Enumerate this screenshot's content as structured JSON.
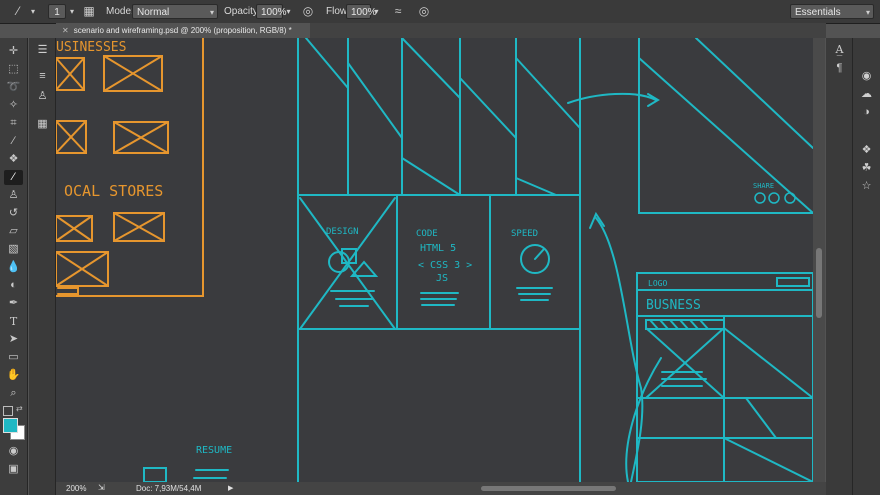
{
  "options_bar": {
    "brush_size": "1",
    "mode_label": "Mode:",
    "mode_value": "Normal",
    "opacity_label": "Opacity:",
    "opacity_value": "100%",
    "flow_label": "Flow:",
    "flow_value": "100%",
    "workspace": "Essentials"
  },
  "document_tab": {
    "title": "scenario and wireframing.psd @ 200% (proposition, RGB/8) *"
  },
  "status_bar": {
    "zoom": "200%",
    "doc_size": "Doc: 7,93M/54,4M"
  },
  "canvas_sketch": {
    "left_orange": {
      "heading_top": "USINESSES",
      "heading_local": "OCAL STORES"
    },
    "features": {
      "design": "DESIGN",
      "code": "CODE",
      "html": "HTML 5",
      "css": "< CSS 3 >",
      "js": "JS",
      "speed": "SPEED"
    },
    "share_label": "SHARE",
    "resume_label": "RESUME",
    "mock_logo": "LOGO",
    "mock_title": "BUSNESS"
  },
  "colors": {
    "accent_cyan": "#1fb8c4",
    "sketch_orange": "#e6962e",
    "canvas_bg": "#3a3b3e"
  },
  "tools": [
    "move-icon",
    "marquee-icon",
    "lasso-icon",
    "quick-select-icon",
    "crop-icon",
    "eyedropper-icon",
    "healing-icon",
    "brush-icon",
    "stamp-icon",
    "history-brush-icon",
    "eraser-icon",
    "gradient-icon",
    "blur-icon",
    "dodge-icon",
    "pen-icon",
    "type-icon",
    "path-select-icon",
    "shape-icon",
    "hand-icon",
    "zoom-icon"
  ]
}
